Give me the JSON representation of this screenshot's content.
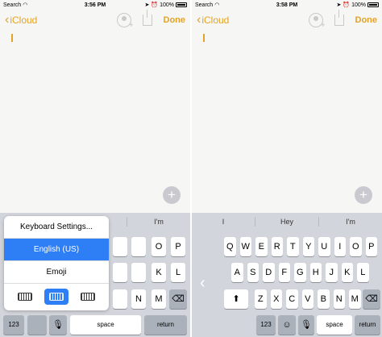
{
  "left": {
    "status": {
      "carrier": "Search",
      "time": "3:56 PM",
      "battery": "100%"
    },
    "nav": {
      "back": "iCloud",
      "done": "Done"
    },
    "suggestions": [
      "",
      "",
      "I'm"
    ],
    "popup": {
      "items": [
        "Keyboard Settings...",
        "English (US)",
        "Emoji"
      ],
      "selected": "English (US)"
    },
    "rows": {
      "row1_visible": [
        "O",
        "P"
      ],
      "row1_partial": [
        "",
        "",
        ""
      ],
      "row2": [
        "K",
        "L"
      ],
      "row3": [
        "N",
        "M"
      ],
      "bottom": {
        "num": "123",
        "space": "space",
        "return": "return"
      }
    }
  },
  "right": {
    "status": {
      "carrier": "Search",
      "time": "3:58 PM",
      "battery": "100%"
    },
    "nav": {
      "back": "iCloud",
      "done": "Done"
    },
    "suggestions": [
      "I",
      "Hey",
      "I'm"
    ],
    "rows": {
      "row1": [
        "Q",
        "W",
        "E",
        "R",
        "T",
        "Y",
        "U",
        "I",
        "O",
        "P"
      ],
      "row2": [
        "A",
        "S",
        "D",
        "F",
        "G",
        "H",
        "J",
        "K",
        "L"
      ],
      "row3": [
        "Z",
        "X",
        "C",
        "V",
        "B",
        "N",
        "M"
      ],
      "bottom": {
        "num": "123",
        "space": "space",
        "return": "return"
      }
    }
  },
  "colors": {
    "accent": "#e4a327",
    "selection": "#2e7ef6",
    "keyboard_bg": "#d2d5db"
  }
}
